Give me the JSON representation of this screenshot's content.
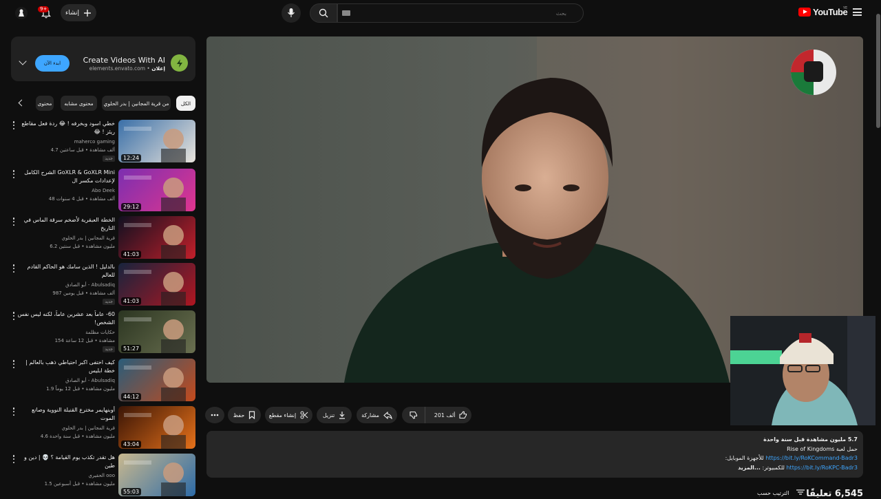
{
  "topbar": {
    "create_label": "إنشاء",
    "notification_count": "9+",
    "search_placeholder": "بحث",
    "logo_text": "YouTube",
    "region": "YE"
  },
  "ad": {
    "title": "Create Videos With AI",
    "sponsored": "إعلان",
    "domain": "elements.envato.com",
    "cta": "ابدء الآن"
  },
  "chips": [
    "الكل",
    "من قرية المجانين | بدر الحلوي",
    "محتوى مشابه",
    "محتوى"
  ],
  "recommendations": [
    {
      "title": "خطي اسود وبخرفه ! 😂 ردة فعل مقاطع ريئز ! 😂",
      "channel": "maherco gaming",
      "meta": "4.7 ألف مشاهدة • قبل ساعتين",
      "badge": "جديد",
      "duration": "12:24",
      "colors": [
        "#3a6fa8",
        "#e9e4dc"
      ]
    },
    {
      "title": "GoXLR & GoXLR Mini الشرح الكامل لإعدادات مكسر ال",
      "channel": "Abo Deek",
      "meta": "48 ألف مشاهدة • قبل 4 سنوات",
      "badge": "",
      "duration": "29:12",
      "colors": [
        "#7b2fb0",
        "#e0358f"
      ]
    },
    {
      "title": "الخطة العبقرية لأضخم سرقة الماس في التاريخ",
      "channel": "قرية المجانين | بدر الحلوي",
      "meta": "6.2 مليون مشاهدة • قبل سنتين",
      "badge": "",
      "duration": "41:03",
      "colors": [
        "#101020",
        "#c21f2a"
      ]
    },
    {
      "title": "بالدليل ! الذين سامك هو الحاكم القادم للعالم",
      "channel": "أبو الصادق - Abulsadiq",
      "meta": "987 ألف مشاهدة • قبل يومين",
      "badge": "جديد",
      "duration": "41:03",
      "colors": [
        "#17243d",
        "#b01621"
      ]
    },
    {
      "title": "60- عاماً بعد عشرين عاماً، لكنه ليس نفس الشخص!",
      "channel": "حكايات مظلمة",
      "meta": "154 مشاهدة • قبل 12 ساعة",
      "badge": "جديد",
      "duration": "51:27",
      "colors": [
        "#2b3521",
        "#6a7050"
      ]
    },
    {
      "title": "كيف اختفى اكبر احتياطي ذهب بالعالم | خطة ابليس",
      "channel": "أبو الصادق - Abulsadiq",
      "meta": "1.9 مليون مشاهدة • قبل 12 يوماً",
      "badge": "",
      "duration": "44:12",
      "colors": [
        "#2a5d7a",
        "#c44a1c"
      ]
    },
    {
      "title": "أوبنهايمر مخترع القنبلة النووية وصانع الموت",
      "channel": "قرية المجانين | بدر الحلوي",
      "meta": "4.6 مليون مشاهدة • قبل سنة واحدة",
      "badge": "",
      "duration": "43:04",
      "colors": [
        "#3a1506",
        "#e6711a"
      ]
    },
    {
      "title": "هل تقدر تكذب يوم القيامة ؟ 💀 | دين و طين",
      "channel": "الحقيري ooo",
      "meta": "1.5 مليون مشاهدة • قبل أسبوعين",
      "badge": "",
      "duration": "55:03",
      "colors": [
        "#c9b88e",
        "#2d6ba7"
      ]
    }
  ],
  "actions": {
    "like_count": "201 ألف",
    "share": "مشاركة",
    "download": "تنزيل",
    "clip": "إنشاء مقطع",
    "save": "حفظ"
  },
  "description": {
    "stats": "5.7 مليون مشاهدة  قبل سنة واحدة",
    "line2": "حمل لعبة Rise of Kingdoms",
    "line3_prefix": "للأجهزة الموبايل:",
    "line3_link": "https://bit.ly/RoKCommand-Badr3",
    "line4_prefix": "...المزيد",
    "line4_mid": "للكمبيوتر:",
    "line4_link": "https://bit.ly/RoKPC-Badr3"
  },
  "comments": {
    "count": "6,545 تعليقًا",
    "sort": "الترتيب حسب"
  }
}
